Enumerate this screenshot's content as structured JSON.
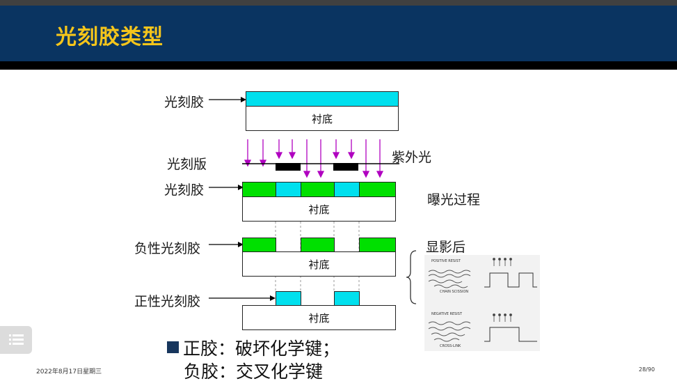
{
  "slide": {
    "title": "光刻胶类型",
    "date": "2022年8月17日星期三",
    "page": "28/90"
  },
  "diagram": {
    "photoresist_label": "光刻胶",
    "substrate_label": "衬底",
    "mask_label": "光刻版",
    "uv_label": "紫外光",
    "exposure_label": "曝光过程",
    "after_develop_label": "显影后",
    "negative_resist_label": "负性光刻胶",
    "positive_resist_label": "正性光刻胶"
  },
  "inset": {
    "positive_title": "POSITIVE RESIST",
    "chain_scission": "CHAIN SCISSION",
    "negative_title": "NEGATIVE RESIST",
    "cross_link": "CROSS-LINK"
  },
  "bullets": {
    "line1": "正胶：破坏化学键；",
    "line2": "负胶：交叉化学键"
  },
  "colors": {
    "header_bg": "#0a3461",
    "title": "#f5c51b",
    "resist_green": "#00e000",
    "resist_cyan": "#00e0ee",
    "uv_arrow": "#b000c0"
  },
  "icons": {
    "menu": "menu-icon"
  }
}
